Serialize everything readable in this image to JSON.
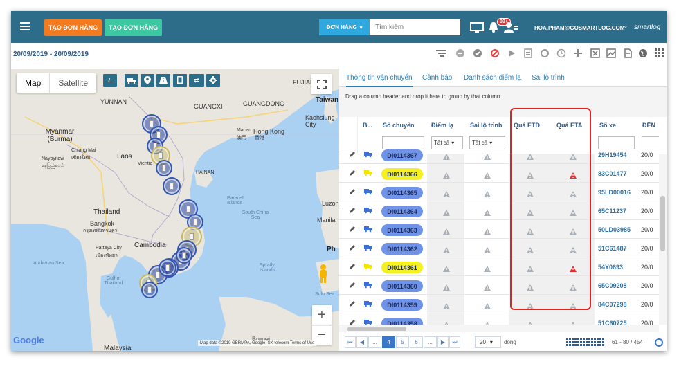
{
  "topbar": {
    "create_order_1": "TẠO ĐƠN HÀNG",
    "create_order_2": "TẠO ĐƠN HÀNG",
    "search_type": "ĐƠN HÀNG",
    "search_placeholder": "Tìm kiếm",
    "notification_badge": "99+",
    "user_email": "HOA.PHAM@GOSMARTLOG.COM",
    "brand": "smartlog",
    "colors": {
      "bar": "#2e6d8a",
      "orange": "#f47a1f",
      "teal": "#3cc8a0",
      "search_blue": "#2ea8df"
    }
  },
  "subbar": {
    "date_range": "20/09/2019 - 20/09/2019",
    "toolbar_icons": [
      "filter-icon",
      "list-icon",
      "check-circle-icon",
      "ban-icon",
      "play-icon",
      "document-icon",
      "refresh-icon",
      "clock-icon",
      "plus-icon",
      "excel-icon",
      "image-icon",
      "export-icon",
      "globe-icon",
      "grid-icon"
    ]
  },
  "map": {
    "type_map": "Map",
    "type_satellite": "Satellite",
    "zoom_in": "+",
    "zoom_out": "−",
    "google": "Google",
    "attribution": "Map data ©2019 GBRMPA, Google, SK telecom    Terms of Use",
    "labels": {
      "yunnan": "YUNNAN",
      "guangxi": "GUANGXI",
      "guangdong": "GUANGDONG",
      "fujian": "FUJIAN",
      "taiwan": "Taiwan",
      "kaohsiung": "Kaohsiung City",
      "myanmar": "Myanmar (Burma)",
      "chiang_mai": "Chiang Mai",
      "chiang_mai_th": "เชียงใหม่",
      "naypyitaw": "Naypyitaw",
      "naypyitaw_mm": "နေပြည်တော်",
      "laos": "Laos",
      "vientiane": "Vientia",
      "macau": "Macau",
      "macau_zh": "澳門",
      "hong_kong": "Hong Kong",
      "hong_kong_zh": "香港",
      "hainan": "HAINAN",
      "thailand": "Thailand",
      "bangkok": "Bangkok",
      "bangkok_th": "กรุงเทพมหานคร",
      "pattaya": "Pattaya City",
      "pattaya_th": "เมืองพัทยา",
      "cambodia": "Cambodia",
      "paracel": "Paracel Islands",
      "south_china_sea": "South China Sea",
      "spratly": "Spratly Islands",
      "andaman": "Andaman Sea",
      "gulf_thailand": "Gulf of Thailand",
      "luzon": "Luzon",
      "manila": "Manila",
      "ph": "Ph",
      "sulu": "Sulu Sea",
      "brunei": "Brunei",
      "malaysia": "Malaysia"
    }
  },
  "tabs": [
    "Thông tin vận chuyển",
    "Cảnh báo",
    "Danh sách điểm lạ",
    "Sai lộ trình"
  ],
  "grid": {
    "drag_hint": "Drag a column header and drop it here to group by that column",
    "columns": {
      "b": "B...",
      "trip": "Số chuyến",
      "strange_point": "Điểm lạ",
      "wrong_route": "Sai lộ trình",
      "over_etd": "Quá ETD",
      "over_eta": "Quá ETA",
      "plate": "Số xe",
      "den": "ĐẾN"
    },
    "filter_all_1": "Tất cả",
    "filter_all_2": "Tất cả",
    "rows": [
      {
        "trip": "DI0114367",
        "highlight": false,
        "eta_alert": false,
        "plate": "29H19454",
        "den": "20/0"
      },
      {
        "trip": "DI0114366",
        "highlight": true,
        "eta_alert": true,
        "plate": "83C01477",
        "den": "20/0"
      },
      {
        "trip": "DI0114365",
        "highlight": false,
        "eta_alert": false,
        "plate": "95LD00016",
        "den": "20/0"
      },
      {
        "trip": "DI0114364",
        "highlight": false,
        "eta_alert": false,
        "plate": "65C11237",
        "den": "20/0"
      },
      {
        "trip": "DI0114363",
        "highlight": false,
        "eta_alert": false,
        "plate": "50LD03985",
        "den": "20/0"
      },
      {
        "trip": "DI0114362",
        "highlight": false,
        "eta_alert": false,
        "plate": "51C61487",
        "den": "20/0"
      },
      {
        "trip": "DI0114361",
        "highlight": true,
        "eta_alert": true,
        "plate": "54Y0693",
        "den": "20/0"
      },
      {
        "trip": "DI0114360",
        "highlight": false,
        "eta_alert": false,
        "plate": "65C09208",
        "den": "20/0"
      },
      {
        "trip": "DI0114359",
        "highlight": false,
        "eta_alert": false,
        "plate": "84C07298",
        "den": "20/0"
      },
      {
        "trip": "DI0114358",
        "highlight": false,
        "eta_alert": false,
        "plate": "51C60725",
        "den": "20/0"
      }
    ]
  },
  "pager": {
    "pages": [
      "...",
      "4",
      "5",
      "6",
      "..."
    ],
    "current_page": "4",
    "page_size": "20",
    "rows_label": "dòng",
    "info": "61 - 80 / 454"
  }
}
